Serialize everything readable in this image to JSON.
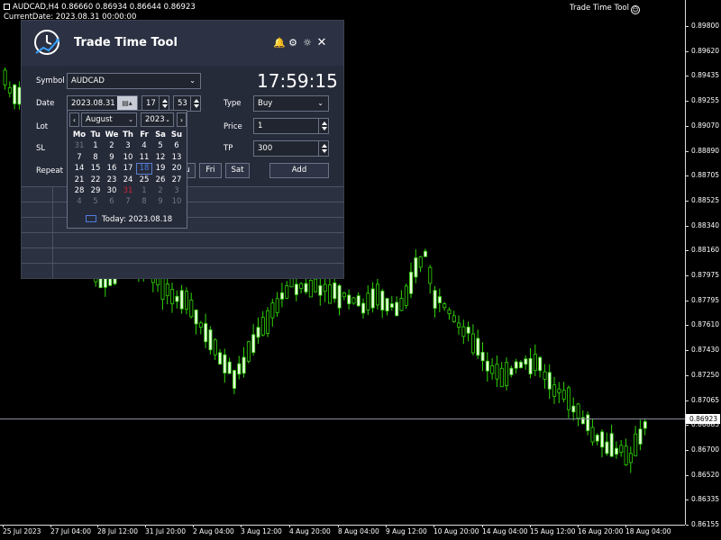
{
  "chart": {
    "info_line1": "AUDCAD,H4  0.86660 0.86934 0.86644 0.86923",
    "info_line2": "CurrentDate: 2023.08.31 00:00:00",
    "indicator_name": "Trade Time Tool",
    "price_ticks": [
      "0.89800",
      "0.89620",
      "0.89435",
      "0.89255",
      "0.89070",
      "0.88890",
      "0.88705",
      "0.88525",
      "0.88340",
      "0.88160",
      "0.87975",
      "0.87795",
      "0.87610",
      "0.87430",
      "0.87250",
      "0.87065",
      "0.86885",
      "0.86700",
      "0.86520",
      "0.86335",
      "0.86155"
    ],
    "current_price": "0.86923",
    "time_ticks": [
      "25 Jul 2023",
      "27 Jul 04:00",
      "28 Jul 12:00",
      "31 Jul 20:00",
      "2 Aug 04:00",
      "3 Aug 12:00",
      "4 Aug 20:00",
      "8 Aug 04:00",
      "9 Aug 12:00",
      "10 Aug 20:00",
      "14 Aug 04:00",
      "15 Aug 12:00",
      "16 Aug 20:00",
      "18 Aug 04:00"
    ],
    "colors": {
      "bull": "#2fd600",
      "bear": "#e8f8e0",
      "line": "#2fd600"
    }
  },
  "panel": {
    "title": "Trade Time Tool",
    "clock": "17:59:15",
    "icons": [
      "bell-icon",
      "gear-icon",
      "sun-icon",
      "close-icon"
    ],
    "symbol_label": "Symbol",
    "symbol_value": "AUDCAD",
    "date_label": "Date",
    "date_value": "2023.08.31",
    "hour_value": "17",
    "minute_value": "53",
    "type_label": "Type",
    "type_value": "Buy",
    "lot_label": "Lot",
    "price_label": "Price",
    "price_value": "1",
    "sl_label": "SL",
    "tp_label": "TP",
    "tp_value": "300",
    "repeat_label": "Repeat",
    "day_buttons": [
      "u",
      "Fri",
      "Sat"
    ],
    "add_button": "Add"
  },
  "calendar": {
    "month": "August",
    "year": "2023",
    "weekdays": [
      "Mo",
      "Tu",
      "We",
      "Th",
      "Fr",
      "Sa",
      "Su"
    ],
    "weeks": [
      [
        "31",
        "1",
        "2",
        "3",
        "4",
        "5",
        "6"
      ],
      [
        "7",
        "8",
        "9",
        "10",
        "11",
        "12",
        "13"
      ],
      [
        "14",
        "15",
        "16",
        "17",
        "18",
        "19",
        "20"
      ],
      [
        "21",
        "22",
        "23",
        "24",
        "25",
        "26",
        "27"
      ],
      [
        "28",
        "29",
        "30",
        "31",
        "1",
        "2",
        "3"
      ],
      [
        "4",
        "5",
        "6",
        "7",
        "8",
        "9",
        "10"
      ]
    ],
    "today_label": "Today: 2023.08.18"
  }
}
